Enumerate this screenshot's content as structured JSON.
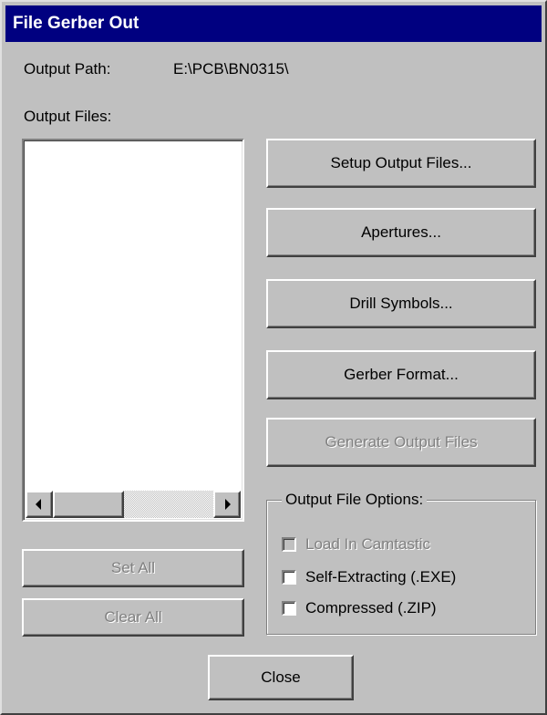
{
  "window": {
    "title": "File Gerber Out"
  },
  "output_path": {
    "label": "Output Path:",
    "value": "E:\\PCB\\BN0315\\"
  },
  "output_files": {
    "label": "Output Files:",
    "items": []
  },
  "buttons": {
    "setup_output_files": "Setup Output Files...",
    "apertures": "Apertures...",
    "drill_symbols": "Drill Symbols...",
    "gerber_format": "Gerber Format...",
    "generate_output_files": "Generate Output Files",
    "set_all": "Set All",
    "clear_all": "Clear All",
    "close": "Close"
  },
  "output_file_options": {
    "legend": "Output File Options:",
    "load_in_camtastic": {
      "label": "Load In Camtastic",
      "checked": false,
      "enabled": false
    },
    "self_extracting": {
      "label": "Self-Extracting (.EXE)",
      "checked": false,
      "enabled": true
    },
    "compressed": {
      "label": "Compressed (.ZIP)",
      "checked": false,
      "enabled": true
    }
  },
  "colors": {
    "title_bar": "#000080",
    "face": "#c0c0c0",
    "disabled_text": "#808080"
  }
}
